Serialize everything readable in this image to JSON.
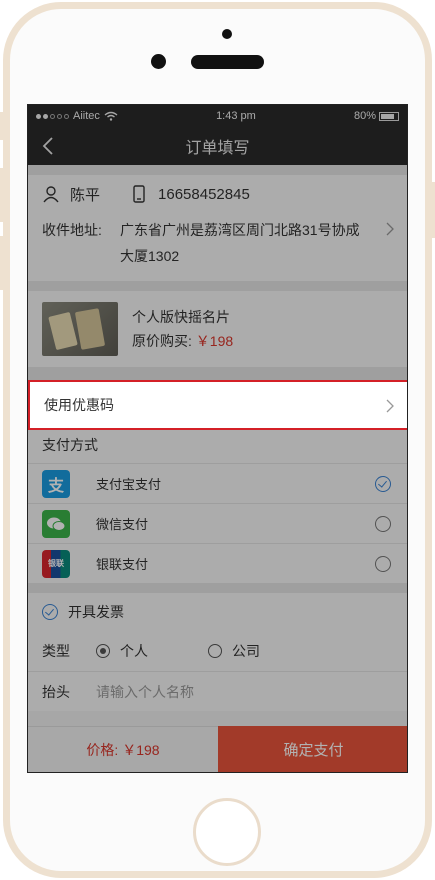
{
  "status_bar": {
    "carrier": "Aiitec",
    "time": "1:43 pm",
    "battery": "80%"
  },
  "nav": {
    "title": "订单填写"
  },
  "contact": {
    "name": "陈平",
    "phone": "16658452845"
  },
  "address": {
    "label": "收件地址:",
    "value": "广东省广州是荔湾区周门北路31号协成大厦1302"
  },
  "product": {
    "name": "个人版快摇名片",
    "price_label": "原价购买:",
    "price": "￥198"
  },
  "coupon": {
    "label": "使用优惠码"
  },
  "payment": {
    "title": "支付方式",
    "options": [
      {
        "label": "支付宝支付",
        "selected": true
      },
      {
        "label": "微信支付",
        "selected": false
      },
      {
        "label": "银联支付",
        "selected": false
      }
    ]
  },
  "invoice": {
    "label": "开具发票",
    "type_label": "类型",
    "type_options": [
      "个人",
      "公司"
    ],
    "title_label": "抬头",
    "title_placeholder": "请输入个人名称"
  },
  "bottom": {
    "total": "价格: ￥198",
    "confirm": "确定支付"
  },
  "colors": {
    "accent": "#e8543b",
    "price": "#d9362b",
    "highlight_border": "#d42027",
    "check": "#3a82d1"
  }
}
